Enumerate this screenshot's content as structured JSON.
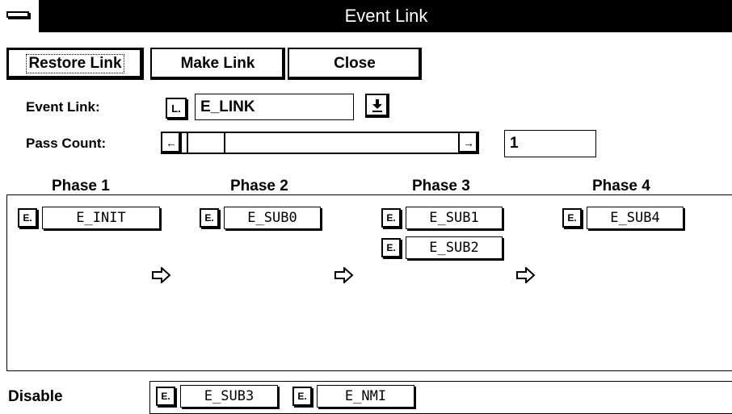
{
  "window": {
    "title": "Event Link"
  },
  "buttons": {
    "restore_label": "Restore Link",
    "make_label": "Make Link",
    "close_label": "Close"
  },
  "event_link": {
    "label": "Event Link:",
    "type_badge": "L.",
    "value": "E_LINK",
    "dropdown_icon": "down-arrow-icon"
  },
  "pass_count": {
    "label": "Pass Count:",
    "value": "1",
    "left_arrow_glyph": "←",
    "right_arrow_glyph": "→"
  },
  "phases": [
    {
      "title": "Phase 1",
      "events": [
        {
          "badge": "E.",
          "name": "E_INIT"
        }
      ]
    },
    {
      "title": "Phase 2",
      "events": [
        {
          "badge": "E.",
          "name": "E_SUB0"
        }
      ]
    },
    {
      "title": "Phase 3",
      "events": [
        {
          "badge": "E.",
          "name": "E_SUB1"
        },
        {
          "badge": "E.",
          "name": "E_SUB2"
        }
      ]
    },
    {
      "title": "Phase 4",
      "events": [
        {
          "badge": "E.",
          "name": "E_SUB4"
        }
      ]
    }
  ],
  "disable": {
    "label": "Disable",
    "events": [
      {
        "badge": "E.",
        "name": "E_SUB3"
      },
      {
        "badge": "E.",
        "name": "E_NMI"
      }
    ]
  }
}
